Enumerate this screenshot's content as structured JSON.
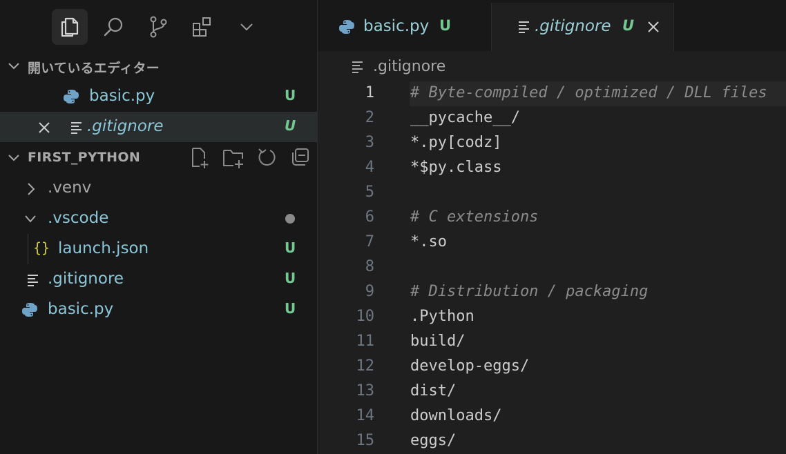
{
  "sidebar": {
    "open_editors": {
      "title": "開いているエディター",
      "items": [
        {
          "name": "basic.py",
          "badge": "U"
        },
        {
          "name": ".gitignore",
          "badge": "U"
        }
      ]
    },
    "explorer": {
      "title": "FIRST_PYTHON",
      "items": [
        {
          "name": ".venv"
        },
        {
          "name": ".vscode"
        },
        {
          "name": "launch.json",
          "badge": "U",
          "icon_text": "{}"
        },
        {
          "name": ".gitignore",
          "badge": "U"
        },
        {
          "name": "basic.py",
          "badge": "U"
        }
      ]
    }
  },
  "editor": {
    "tabs": [
      {
        "label": "basic.py",
        "badge": "U"
      },
      {
        "label": ".gitignore",
        "badge": "U"
      }
    ],
    "breadcrumb": ".gitignore",
    "lines": [
      {
        "n": "1",
        "text": "# Byte-compiled / optimized / DLL files"
      },
      {
        "n": "2",
        "text": "__pycache__/"
      },
      {
        "n": "3",
        "text": "*.py[codz]"
      },
      {
        "n": "4",
        "text": "*$py.class"
      },
      {
        "n": "5",
        "text": ""
      },
      {
        "n": "6",
        "text": "# C extensions"
      },
      {
        "n": "7",
        "text": "*.so"
      },
      {
        "n": "8",
        "text": ""
      },
      {
        "n": "9",
        "text": "# Distribution / packaging"
      },
      {
        "n": "10",
        "text": ".Python"
      },
      {
        "n": "11",
        "text": "build/"
      },
      {
        "n": "12",
        "text": "develop-eggs/"
      },
      {
        "n": "13",
        "text": "dist/"
      },
      {
        "n": "14",
        "text": "downloads/"
      },
      {
        "n": "15",
        "text": "eggs/"
      }
    ]
  },
  "colors": {
    "untracked": "#73c991",
    "file_name": "#8ac6d7",
    "comment": "#8b8b8b"
  }
}
